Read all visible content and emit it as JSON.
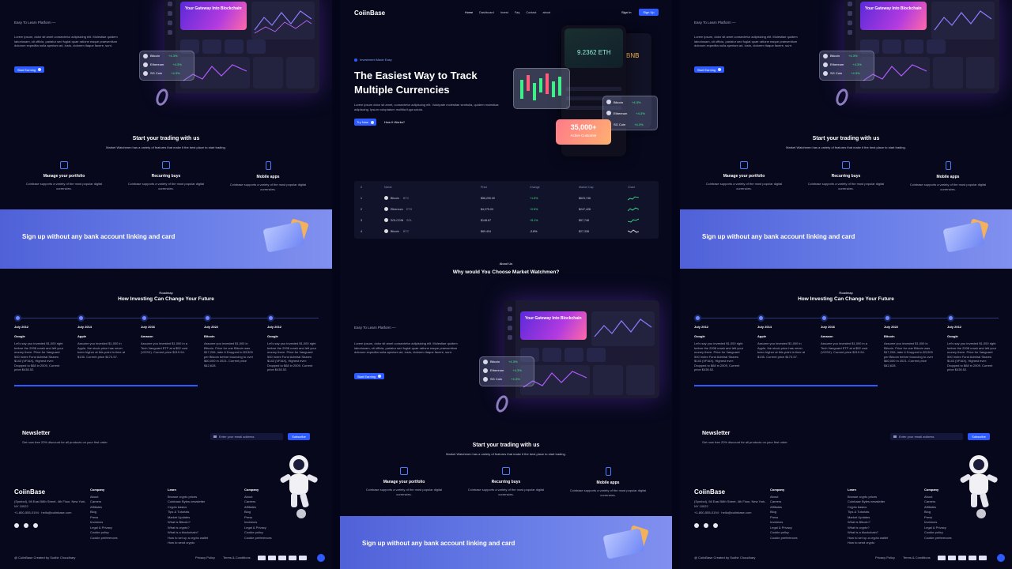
{
  "app": {
    "brand": "CoiinBase"
  },
  "nav": {
    "items": [
      "Home",
      "Dashboard",
      "Invest",
      "Faq",
      "Contact",
      "about"
    ],
    "signin": "Sign In",
    "signup": "Sign Up"
  },
  "hero": {
    "badge": "Investment Made Easy",
    "title": "The Easiest Way to Track Multiple Currencies",
    "desc": "Lorem ipsum dolor sit amet, consectetur adipiscing elit. Volutpate molestiae sentiulla, quidem molestiae adipiscing. Ipsum voluptatum mollitia fuga soluta.",
    "try_now": "Try Now",
    "how_works": "How It Works?",
    "eth_value": "9.2362 ETH",
    "bnb": "BNB",
    "customers_count": "35,000+",
    "customers_label": "Active Customer"
  },
  "market_table": {
    "headers": [
      "#",
      "Name",
      "Price",
      "Change",
      "Market Cap",
      "Chart"
    ],
    "rows": [
      {
        "rank": "1",
        "name": "Bitcoin",
        "ticker": "BTC",
        "price": "$56,290.30",
        "change": "+1.5%",
        "cap": "$623,746",
        "up": true
      },
      {
        "rank": "2",
        "name": "Ethereum",
        "ticker": "ETH",
        "price": "$4,275.03",
        "change": "+2.5%",
        "cap": "$247,428",
        "up": true
      },
      {
        "rank": "3",
        "name": "SOLCOIN",
        "ticker": "SOL",
        "price": "$148.67",
        "change": "+5.1%",
        "cap": "$57,748",
        "up": true
      },
      {
        "rank": "4",
        "name": "Bitcoin",
        "ticker": "BTC",
        "price": "$69.404",
        "change": "-2.8%",
        "cap": "$27,338",
        "up": false
      }
    ]
  },
  "about": {
    "label": "About Us",
    "title": "Why would You Choose Market Watchmen?"
  },
  "platform": {
    "tag": "Easy To Learn Platform —",
    "desc": "Lorem ipsum, dolor sit amet consectetur adipisicing elit. Molestiae quidem laboriosam, sit officia, pariatur sed fugiat quae ratione eaque praesentium dolorum expedita nulla aperiam ad, iusto, dolorem itaque facere, sunt.",
    "cta": "Start Earning",
    "dash_hero": "Your Gateway Into Blockchain",
    "coins": [
      {
        "name": "Bitcoin",
        "sym": "BTC",
        "chg": "+4.3%"
      },
      {
        "name": "Ethereum",
        "sym": "ETH",
        "chg": "+4.3%"
      },
      {
        "name": "SG Coin",
        "sym": "SGC",
        "chg": "+4.3%"
      }
    ]
  },
  "trading": {
    "title": "Start your trading with us",
    "subtitle": "Market Watchmen has a variety of features that make it the best place to start trading.",
    "features": [
      {
        "title": "Manage your portfolio",
        "desc": "Coinbase supports a variety of the most popular digital currencies."
      },
      {
        "title": "Recurring buys",
        "desc": "Coinbase supports a variety of the most popular digital currencies."
      },
      {
        "title": "Mobile apps",
        "desc": "Coinbase supports a variety of the most popular digital currencies."
      }
    ]
  },
  "banner": {
    "text": "Sign up without any bank account linking and card"
  },
  "roadmap": {
    "label": "Roadmap",
    "title": "How Investing Can Change Your Future",
    "items": [
      {
        "date": "July 2012",
        "name": "Google",
        "text": "Let's say you invested $1,000 right before the 2008 crash and left your money there. Price for Vanguard 500 Index Fund Admiral Shares $143 (VFIAX), Highest ever: Dropped to $68 in 2009, Current price $436.52."
      },
      {
        "date": "July 2014",
        "name": "Apple",
        "text": "Assume you invested $1,000 in Apple, the stock price has never been higher at this point in time at $135. Current price $173.57."
      },
      {
        "date": "July 2016",
        "name": "Amazon",
        "text": "Assume you invested $1,000 in a Tech Vanguard ETF at a $52 cost (VGSX). Current price $219.94."
      },
      {
        "date": "July 2022",
        "name": "Bitcoin",
        "text": "Assume you invested $1,000 in Bitcoin. Price for one Bitcoin was $17,206, later it Dropped to $3,500 per Bitcoin before bouncing to over $60,000 in 2021. Current price $42,628."
      },
      {
        "date": "July 2012",
        "name": "Google",
        "text": "Let's say you invested $1,000 right before the 2008 crash and left your money there. Price for Vanguard 500 Index Fund Admiral Shares $143 (VFIAX), Highest ever: Dropped to $68 in 2009. Current price $436.52."
      }
    ]
  },
  "newsletter": {
    "title": "Newsletter",
    "subtitle": "Get now free 20% discount for all products on your first order",
    "placeholder": "Enter your email address",
    "button": "Subscribe"
  },
  "footer": {
    "brand": "CoiinBase",
    "address": "(Symbol), 98 East 58th Street, 4th Floor, New York, NY 10022",
    "contact": "+1-800-555-0194 · hello@coiinbase.com",
    "company1": {
      "title": "Company",
      "links": [
        "About",
        "Careers",
        "Affiliates",
        "Blog",
        "Press",
        "Investors",
        "Legal & Privacy",
        "Cookie policy",
        "Cookie preferences"
      ]
    },
    "learn": {
      "title": "Learn",
      "links": [
        "Browse crypto prices",
        "Coinbase Bytes newsletter",
        "Crypto basics",
        "Tips & Tutorials",
        "Market Updates",
        "What is Bitcoin?",
        "What is crypto?",
        "What is a blockchain?",
        "How to set up a crypto wallet",
        "How to send crypto"
      ]
    },
    "company2": {
      "title": "Company",
      "links": [
        "About",
        "Careers",
        "Affiliates",
        "Blog",
        "Press",
        "Investors",
        "Legal & Privacy",
        "Cookie policy",
        "Cookie preferences"
      ]
    },
    "copyright": "@ CoiinBase Created by Sudhir Choudhary",
    "privacy": "Privacy Policy",
    "terms": "Terms & Conditions"
  },
  "colors": {
    "accent": "#2d5bff",
    "up": "#3ef08a",
    "down": "#ff5c7a",
    "bg": "#07081c"
  }
}
